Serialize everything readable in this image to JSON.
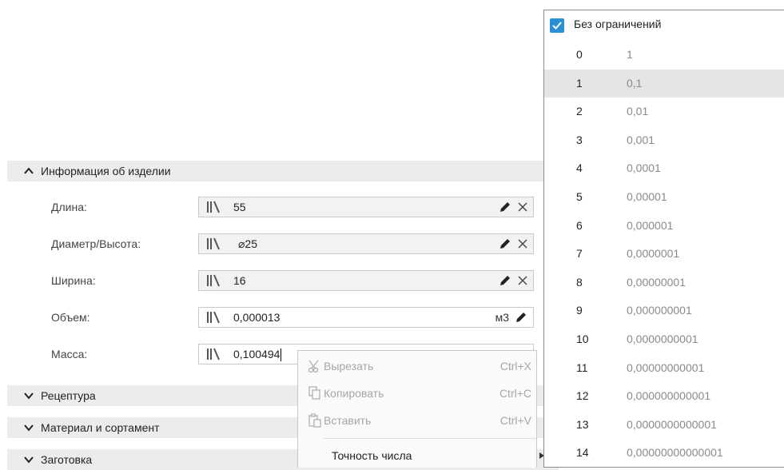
{
  "sections": {
    "info_label": "Информация об изделии",
    "recipe_label": "Рецептура",
    "material_label": "Материал и сортамент",
    "blank_label": "Заготовка"
  },
  "properties": [
    {
      "label": "Длина:",
      "value": "55"
    },
    {
      "label": "Диаметр/Высота:",
      "value": "⌀25"
    },
    {
      "label": "Ширина:",
      "value": "16"
    },
    {
      "label": "Объем:",
      "value": "0,000013",
      "unit": "м3"
    },
    {
      "label": "Масса:",
      "value": "0,100494"
    }
  ],
  "context_menu": {
    "cut": {
      "label": "Вырезать",
      "shortcut": "Ctrl+X"
    },
    "copy": {
      "label": "Копировать",
      "shortcut": "Ctrl+C"
    },
    "paste": {
      "label": "Вставить",
      "shortcut": "Ctrl+V"
    },
    "precision": {
      "label": "Точность числа"
    }
  },
  "precision_dropdown": {
    "no_limit_label": "Без ограничений",
    "no_limit_checked": true,
    "selected_index": 1,
    "options": [
      {
        "idx": "0",
        "val": "1"
      },
      {
        "idx": "1",
        "val": "0,1"
      },
      {
        "idx": "2",
        "val": "0,01"
      },
      {
        "idx": "3",
        "val": "0,001"
      },
      {
        "idx": "4",
        "val": "0,0001"
      },
      {
        "idx": "5",
        "val": "0,00001"
      },
      {
        "idx": "6",
        "val": "0,000001"
      },
      {
        "idx": "7",
        "val": "0,0000001"
      },
      {
        "idx": "8",
        "val": "0,00000001"
      },
      {
        "idx": "9",
        "val": "0,000000001"
      },
      {
        "idx": "10",
        "val": "0,0000000001"
      },
      {
        "idx": "11",
        "val": "0,00000000001"
      },
      {
        "idx": "12",
        "val": "0,000000000001"
      },
      {
        "idx": "13",
        "val": "0,0000000000001"
      },
      {
        "idx": "14",
        "val": "0,00000000000001"
      }
    ]
  },
  "colors": {
    "checkbox": "#2b8fd6",
    "selected_row": "#e5e5e5",
    "section_bg": "#ececec"
  }
}
